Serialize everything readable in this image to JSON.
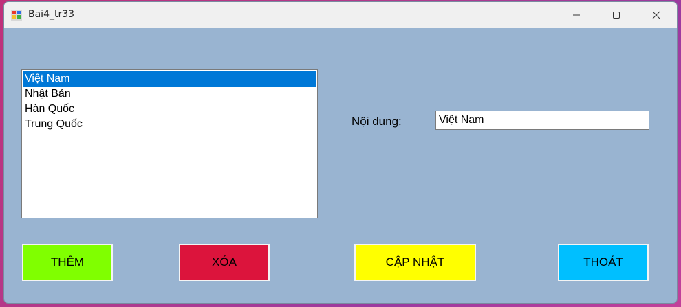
{
  "window": {
    "title": "Bai4_tr33",
    "background_color": "#99b4d1",
    "controls": [
      "minimize-icon",
      "maximize-icon",
      "close-icon"
    ]
  },
  "listbox": {
    "items": [
      {
        "label": "Việt Nam",
        "selected": true
      },
      {
        "label": "Nhật Bản",
        "selected": false
      },
      {
        "label": "Hàn Quốc",
        "selected": false
      },
      {
        "label": "Trung Quốc",
        "selected": false
      }
    ],
    "selection_color": "#0078d7"
  },
  "content": {
    "label": "Nội dung:",
    "value": "Việt Nam"
  },
  "buttons": {
    "add": {
      "label": "THÊM",
      "color": "#80ff00"
    },
    "delete": {
      "label": "XÓA",
      "color": "#dc143c"
    },
    "update": {
      "label": "CẬP NHẬT",
      "color": "#ffff00"
    },
    "exit": {
      "label": "THOÁT",
      "color": "#00bfff"
    }
  }
}
